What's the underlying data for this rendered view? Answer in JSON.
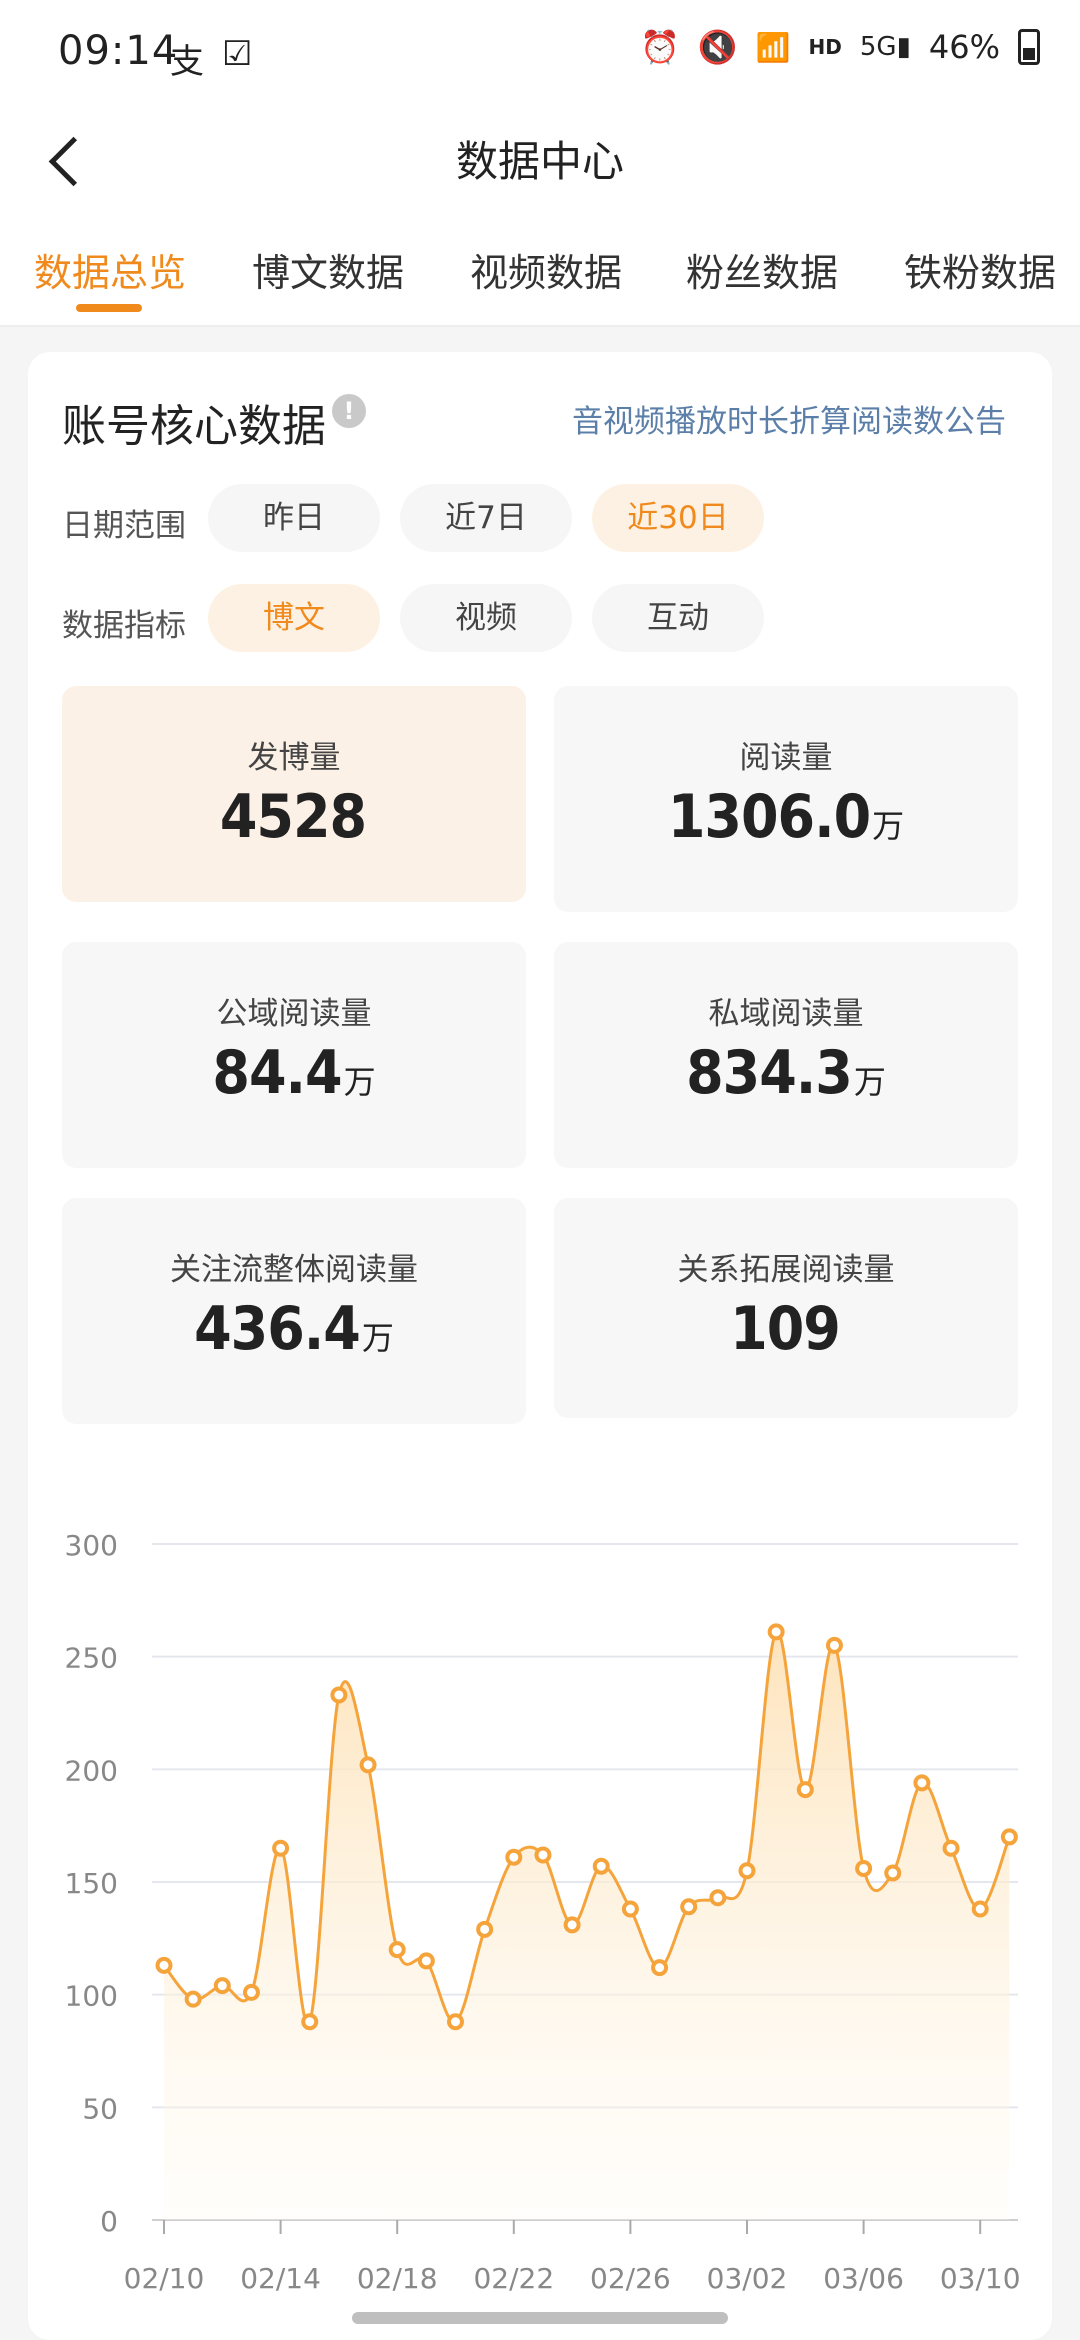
{
  "status_bar": {
    "time": "09:14",
    "left_icons": [
      "alipay-icon",
      "checkbox-icon"
    ],
    "right_icons": [
      "alarm-icon",
      "mute-icon",
      "wifi-icon",
      "hd-icon",
      "5g-signal-icon"
    ],
    "battery": "46%"
  },
  "nav": {
    "title": "数据中心"
  },
  "tabs": [
    {
      "label": "数据总览",
      "active": true
    },
    {
      "label": "博文数据",
      "active": false
    },
    {
      "label": "视频数据",
      "active": false
    },
    {
      "label": "粉丝数据",
      "active": false
    },
    {
      "label": "铁粉数据",
      "active": false
    }
  ],
  "card": {
    "title": "账号核心数据",
    "notice_link": "音视频播放时长折算阅读数公告",
    "date_range": {
      "label": "日期范围",
      "options": [
        "昨日",
        "近7日",
        "近30日"
      ],
      "selected": "近30日"
    },
    "metric_type": {
      "label": "数据指标",
      "options": [
        "博文",
        "视频",
        "互动"
      ],
      "selected": "博文"
    },
    "metrics": [
      {
        "label": "发博量",
        "value": "4528",
        "unit": ""
      },
      {
        "label": "阅读量",
        "value": "1306.0",
        "unit": "万"
      },
      {
        "label": "公域阅读量",
        "value": "84.4",
        "unit": "万"
      },
      {
        "label": "私域阅读量",
        "value": "834.3",
        "unit": "万"
      },
      {
        "label": "关注流整体阅读量",
        "value": "436.4",
        "unit": "万"
      },
      {
        "label": "关系拓展阅读量",
        "value": "109",
        "unit": ""
      }
    ]
  },
  "chart_data": {
    "type": "area",
    "y_ticks": [
      0,
      50,
      100,
      150,
      200,
      250,
      300
    ],
    "ylim": [
      0,
      300
    ],
    "x_tick_labels": [
      "02/10",
      "02/14",
      "02/18",
      "02/22",
      "02/26",
      "03/02",
      "03/06",
      "03/10"
    ],
    "x": [
      "02/10",
      "02/11",
      "02/12",
      "02/13",
      "02/14",
      "02/15",
      "02/16",
      "02/17",
      "02/18",
      "02/19",
      "02/20",
      "02/21",
      "02/22",
      "02/23",
      "02/24",
      "02/25",
      "02/26",
      "02/27",
      "02/28",
      "02/29",
      "03/01",
      "03/02",
      "03/03",
      "03/04",
      "03/05",
      "03/06",
      "03/07",
      "03/08",
      "03/09",
      "03/10",
      "03/11"
    ],
    "values": [
      113,
      98,
      104,
      101,
      165,
      88,
      233,
      202,
      120,
      115,
      88,
      129,
      161,
      162,
      131,
      157,
      138,
      112,
      139,
      143,
      155,
      261,
      191,
      255,
      156,
      154,
      194,
      165,
      138,
      170
    ],
    "grid": true,
    "colors": {
      "line": "#f5a43c",
      "fill_top": "#fde2b8",
      "fill_bottom": "#fffaf2"
    }
  },
  "colors": {
    "accent": "#f08a1c",
    "link": "#5b7fa8"
  }
}
